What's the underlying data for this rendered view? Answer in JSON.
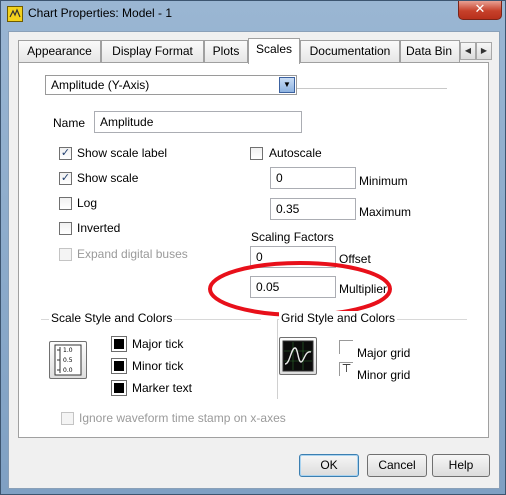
{
  "window": {
    "title": "Chart Properties: Model - 1",
    "close_glyph": "✕"
  },
  "tabs": [
    {
      "label": "Appearance"
    },
    {
      "label": "Display Format"
    },
    {
      "label": "Plots"
    },
    {
      "label": "Scales",
      "active": true
    },
    {
      "label": "Documentation"
    },
    {
      "label": "Data Bin"
    }
  ],
  "tab_scroll": {
    "left": "◀",
    "right": "▶"
  },
  "scale_select": {
    "value": "Amplitude (Y-Axis)",
    "arrow": "▼"
  },
  "name": {
    "label": "Name",
    "value": "Amplitude"
  },
  "options": {
    "show_scale_label": {
      "label": "Show scale label",
      "checked": true
    },
    "show_scale": {
      "label": "Show scale",
      "checked": true
    },
    "log": {
      "label": "Log",
      "checked": false
    },
    "inverted": {
      "label": "Inverted",
      "checked": false
    },
    "expand_digital_buses": {
      "label": "Expand digital buses",
      "checked": false,
      "enabled": false
    },
    "autoscale": {
      "label": "Autoscale",
      "checked": false
    }
  },
  "check_glyph": "✓",
  "range": {
    "minimum": {
      "label": "Minimum",
      "value": "0"
    },
    "maximum": {
      "label": "Maximum",
      "value": "0.35"
    }
  },
  "scaling": {
    "heading": "Scaling Factors",
    "offset": {
      "label": "Offset",
      "value": "0"
    },
    "multiplier": {
      "label": "Multiplier",
      "value": "0.05"
    }
  },
  "annotation": {
    "color": "#e8101a"
  },
  "scale_style": {
    "heading": "Scale Style and Colors",
    "icon_labels": [
      "1.0",
      "0.5",
      "0.0"
    ],
    "items": [
      {
        "label": "Major tick",
        "color": "#000000"
      },
      {
        "label": "Minor tick",
        "color": "#000000"
      },
      {
        "label": "Marker text",
        "color": "#000000"
      }
    ]
  },
  "grid_style": {
    "heading": "Grid Style and Colors",
    "major_grid": "Major grid",
    "minor_grid": "Minor grid",
    "minor_glyph": "⊤"
  },
  "ignore_timestamp": {
    "label": "Ignore waveform time stamp on x-axes",
    "checked": false,
    "enabled": false
  },
  "buttons": {
    "ok": "OK",
    "cancel": "Cancel",
    "help": "Help"
  }
}
